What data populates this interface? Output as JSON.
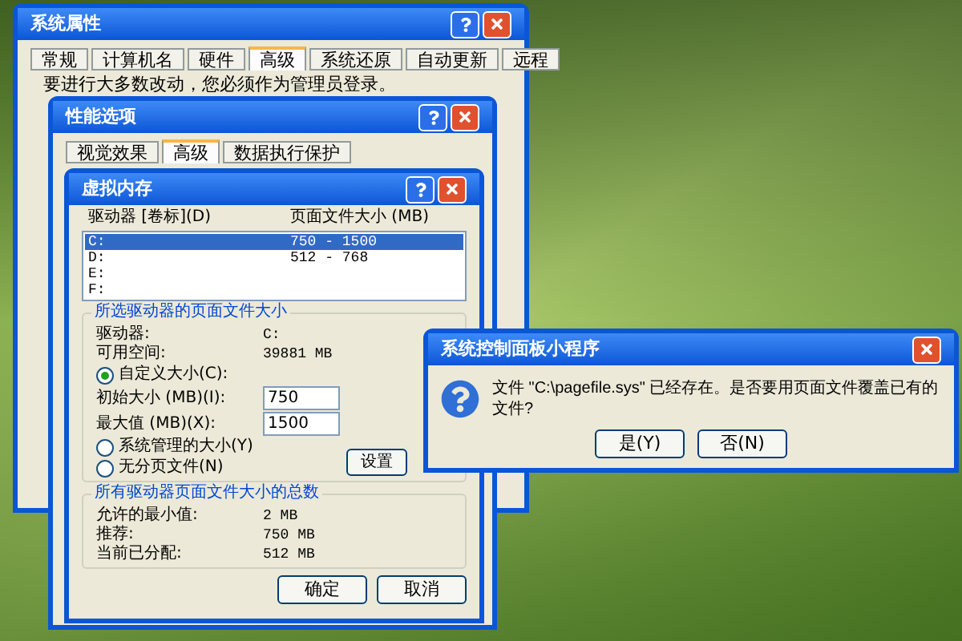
{
  "system_properties": {
    "title": "系统属性",
    "tabs": [
      {
        "label": "常规",
        "selected": false
      },
      {
        "label": "计算机名",
        "selected": false
      },
      {
        "label": "硬件",
        "selected": false
      },
      {
        "label": "高级",
        "selected": true
      },
      {
        "label": "系统还原",
        "selected": false
      },
      {
        "label": "自动更新",
        "selected": false
      },
      {
        "label": "远程",
        "selected": false
      }
    ],
    "note": "要进行大多数改动，您必须作为管理员登录。"
  },
  "performance_options": {
    "title": "性能选项",
    "tabs": [
      {
        "label": "视觉效果",
        "selected": false
      },
      {
        "label": "高级",
        "selected": true
      },
      {
        "label": "数据执行保护",
        "selected": false
      }
    ]
  },
  "virtual_memory": {
    "title": "虚拟内存",
    "columns": [
      "驱动器 [卷标](D)",
      "页面文件大小 (MB)"
    ],
    "drives": [
      {
        "drive": "C:",
        "size": "750 - 1500",
        "selected": true
      },
      {
        "drive": "D:",
        "size": "512 - 768",
        "selected": false
      },
      {
        "drive": "E:",
        "selected": false
      },
      {
        "drive": "F:",
        "selected": false
      }
    ],
    "selected_drive": {
      "legend": "所选驱动器的页面文件大小",
      "info": [
        {
          "label": "驱动器:",
          "value": "C:"
        },
        {
          "label": "可用空间:",
          "value": "39881 MB"
        }
      ],
      "options": [
        {
          "kind": "radio",
          "label": "自定义大小(C):",
          "selected": true
        },
        {
          "kind": "field",
          "label": "初始大小 (MB)(I):",
          "value": "750"
        },
        {
          "kind": "field",
          "label": "最大值 (MB)(X):",
          "value": "1500"
        },
        {
          "kind": "radio",
          "label": "系统管理的大小(Y)",
          "selected": false
        },
        {
          "kind": "radio",
          "label": "无分页文件(N)",
          "selected": false
        }
      ],
      "set_button": "设置"
    },
    "totals": {
      "legend": "所有驱动器页面文件大小的总数",
      "rows": [
        {
          "label": "允许的最小值:",
          "value": "2 MB"
        },
        {
          "label": "推荐:",
          "value": "750 MB"
        },
        {
          "label": "当前已分配:",
          "value": "512 MB"
        }
      ]
    },
    "buttons": [
      "确定",
      "取消"
    ]
  },
  "message": {
    "title": "系统控制面板小程序",
    "text": "文件 \"C:\\pagefile.sys\" 已经存在。是否要用页面文件覆盖已有的文件?",
    "buttons": [
      "是(Y)",
      "否(N)"
    ]
  }
}
